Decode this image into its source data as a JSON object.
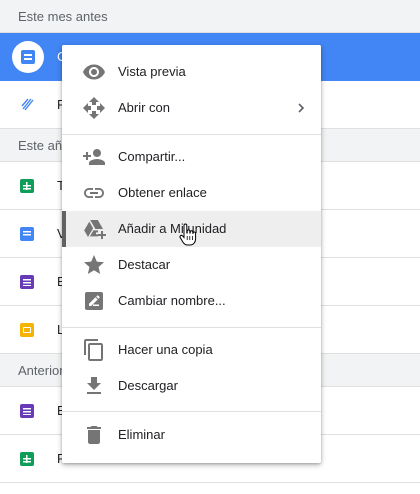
{
  "sections": [
    {
      "title": "Este mes antes"
    },
    {
      "title": "Este año"
    },
    {
      "title": "Anterior"
    }
  ],
  "files": [
    {
      "name": "C",
      "icon": "doc-icon",
      "selected": true
    },
    {
      "name": "F",
      "icon": "zip-icon"
    },
    {
      "name": "T",
      "icon": "sheet-icon"
    },
    {
      "name": "V",
      "icon": "doc-icon"
    },
    {
      "name": "E",
      "icon": "form-icon"
    },
    {
      "name": "L",
      "icon": "slide-icon"
    },
    {
      "name": "E",
      "icon": "form-icon"
    },
    {
      "name": "P",
      "icon": "sheet-icon"
    }
  ],
  "menu": {
    "items": [
      {
        "label": "Vista previa",
        "icon": "eye-icon"
      },
      {
        "label": "Abrir con",
        "icon": "move-arrows-icon",
        "submenu": true
      },
      {
        "label": "Compartir...",
        "icon": "add-person-icon"
      },
      {
        "label": "Obtener enlace",
        "icon": "link-icon"
      },
      {
        "label": "Añadir a Mi unidad",
        "icon": "drive-add-icon",
        "highlighted": true
      },
      {
        "label": "Destacar",
        "icon": "star-icon"
      },
      {
        "label": "Cambiar nombre...",
        "icon": "rename-icon"
      },
      {
        "label": "Hacer una copia",
        "icon": "copy-icon"
      },
      {
        "label": "Descargar",
        "icon": "download-icon"
      },
      {
        "label": "Eliminar",
        "icon": "trash-icon"
      }
    ]
  },
  "colors": {
    "selected_row": "#4285f4",
    "menu_icon": "#757575",
    "highlight_bg": "#eeeeee"
  }
}
